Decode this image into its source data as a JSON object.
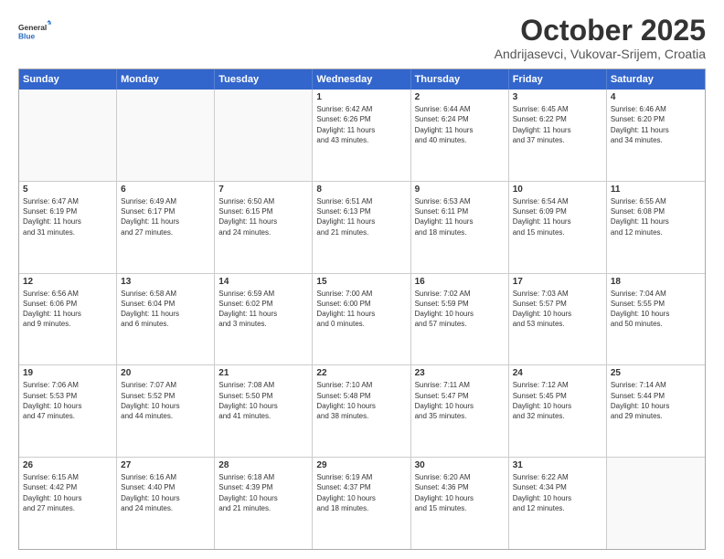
{
  "logo": {
    "line1": "General",
    "line2": "Blue"
  },
  "title": "October 2025",
  "subtitle": "Andrijasevci, Vukovar-Srijem, Croatia",
  "days": [
    "Sunday",
    "Monday",
    "Tuesday",
    "Wednesday",
    "Thursday",
    "Friday",
    "Saturday"
  ],
  "weeks": [
    [
      {
        "num": "",
        "text": ""
      },
      {
        "num": "",
        "text": ""
      },
      {
        "num": "",
        "text": ""
      },
      {
        "num": "1",
        "text": "Sunrise: 6:42 AM\nSunset: 6:26 PM\nDaylight: 11 hours\nand 43 minutes."
      },
      {
        "num": "2",
        "text": "Sunrise: 6:44 AM\nSunset: 6:24 PM\nDaylight: 11 hours\nand 40 minutes."
      },
      {
        "num": "3",
        "text": "Sunrise: 6:45 AM\nSunset: 6:22 PM\nDaylight: 11 hours\nand 37 minutes."
      },
      {
        "num": "4",
        "text": "Sunrise: 6:46 AM\nSunset: 6:20 PM\nDaylight: 11 hours\nand 34 minutes."
      }
    ],
    [
      {
        "num": "5",
        "text": "Sunrise: 6:47 AM\nSunset: 6:19 PM\nDaylight: 11 hours\nand 31 minutes."
      },
      {
        "num": "6",
        "text": "Sunrise: 6:49 AM\nSunset: 6:17 PM\nDaylight: 11 hours\nand 27 minutes."
      },
      {
        "num": "7",
        "text": "Sunrise: 6:50 AM\nSunset: 6:15 PM\nDaylight: 11 hours\nand 24 minutes."
      },
      {
        "num": "8",
        "text": "Sunrise: 6:51 AM\nSunset: 6:13 PM\nDaylight: 11 hours\nand 21 minutes."
      },
      {
        "num": "9",
        "text": "Sunrise: 6:53 AM\nSunset: 6:11 PM\nDaylight: 11 hours\nand 18 minutes."
      },
      {
        "num": "10",
        "text": "Sunrise: 6:54 AM\nSunset: 6:09 PM\nDaylight: 11 hours\nand 15 minutes."
      },
      {
        "num": "11",
        "text": "Sunrise: 6:55 AM\nSunset: 6:08 PM\nDaylight: 11 hours\nand 12 minutes."
      }
    ],
    [
      {
        "num": "12",
        "text": "Sunrise: 6:56 AM\nSunset: 6:06 PM\nDaylight: 11 hours\nand 9 minutes."
      },
      {
        "num": "13",
        "text": "Sunrise: 6:58 AM\nSunset: 6:04 PM\nDaylight: 11 hours\nand 6 minutes."
      },
      {
        "num": "14",
        "text": "Sunrise: 6:59 AM\nSunset: 6:02 PM\nDaylight: 11 hours\nand 3 minutes."
      },
      {
        "num": "15",
        "text": "Sunrise: 7:00 AM\nSunset: 6:00 PM\nDaylight: 11 hours\nand 0 minutes."
      },
      {
        "num": "16",
        "text": "Sunrise: 7:02 AM\nSunset: 5:59 PM\nDaylight: 10 hours\nand 57 minutes."
      },
      {
        "num": "17",
        "text": "Sunrise: 7:03 AM\nSunset: 5:57 PM\nDaylight: 10 hours\nand 53 minutes."
      },
      {
        "num": "18",
        "text": "Sunrise: 7:04 AM\nSunset: 5:55 PM\nDaylight: 10 hours\nand 50 minutes."
      }
    ],
    [
      {
        "num": "19",
        "text": "Sunrise: 7:06 AM\nSunset: 5:53 PM\nDaylight: 10 hours\nand 47 minutes."
      },
      {
        "num": "20",
        "text": "Sunrise: 7:07 AM\nSunset: 5:52 PM\nDaylight: 10 hours\nand 44 minutes."
      },
      {
        "num": "21",
        "text": "Sunrise: 7:08 AM\nSunset: 5:50 PM\nDaylight: 10 hours\nand 41 minutes."
      },
      {
        "num": "22",
        "text": "Sunrise: 7:10 AM\nSunset: 5:48 PM\nDaylight: 10 hours\nand 38 minutes."
      },
      {
        "num": "23",
        "text": "Sunrise: 7:11 AM\nSunset: 5:47 PM\nDaylight: 10 hours\nand 35 minutes."
      },
      {
        "num": "24",
        "text": "Sunrise: 7:12 AM\nSunset: 5:45 PM\nDaylight: 10 hours\nand 32 minutes."
      },
      {
        "num": "25",
        "text": "Sunrise: 7:14 AM\nSunset: 5:44 PM\nDaylight: 10 hours\nand 29 minutes."
      }
    ],
    [
      {
        "num": "26",
        "text": "Sunrise: 6:15 AM\nSunset: 4:42 PM\nDaylight: 10 hours\nand 27 minutes."
      },
      {
        "num": "27",
        "text": "Sunrise: 6:16 AM\nSunset: 4:40 PM\nDaylight: 10 hours\nand 24 minutes."
      },
      {
        "num": "28",
        "text": "Sunrise: 6:18 AM\nSunset: 4:39 PM\nDaylight: 10 hours\nand 21 minutes."
      },
      {
        "num": "29",
        "text": "Sunrise: 6:19 AM\nSunset: 4:37 PM\nDaylight: 10 hours\nand 18 minutes."
      },
      {
        "num": "30",
        "text": "Sunrise: 6:20 AM\nSunset: 4:36 PM\nDaylight: 10 hours\nand 15 minutes."
      },
      {
        "num": "31",
        "text": "Sunrise: 6:22 AM\nSunset: 4:34 PM\nDaylight: 10 hours\nand 12 minutes."
      },
      {
        "num": "",
        "text": ""
      }
    ]
  ]
}
